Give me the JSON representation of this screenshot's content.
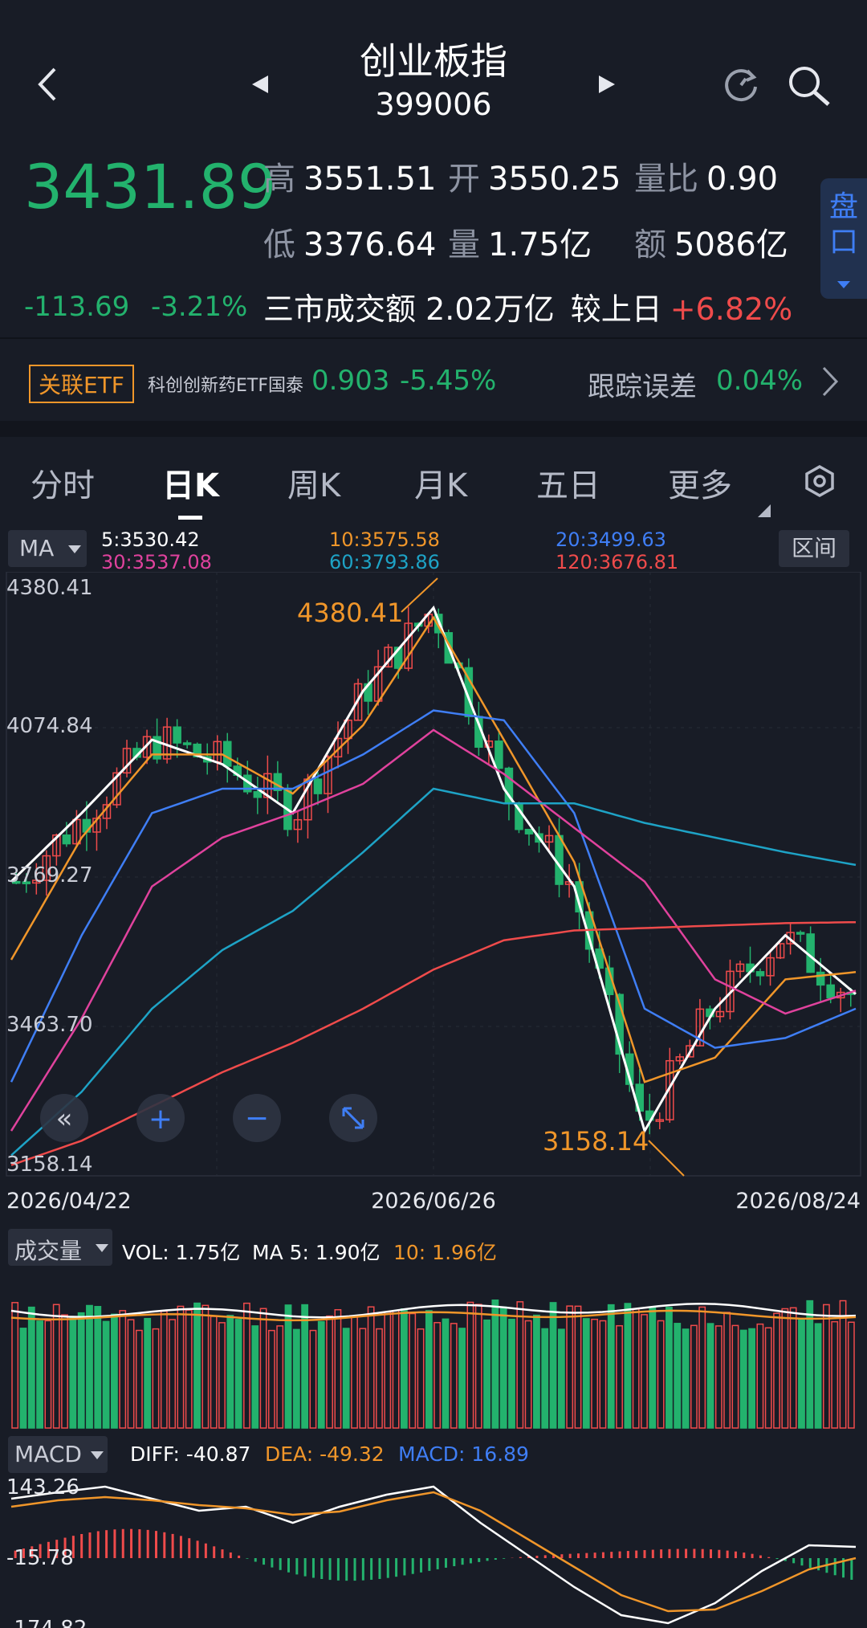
{
  "header": {
    "title": "创业板指",
    "code": "399006",
    "back_icon": "chevron-left-icon",
    "prev_icon": "triangle-left-icon",
    "next_icon": "triangle-right-icon",
    "refresh_icon": "refresh-icon",
    "search_icon": "search-icon"
  },
  "quote": {
    "price": "3431.89",
    "change": "-113.69",
    "change_pct": "-3.21%",
    "high_label": "高",
    "high": "3551.51",
    "open_label": "开",
    "open": "3550.25",
    "ratio_label": "量比",
    "ratio": "0.90",
    "low_label": "低",
    "low": "3376.64",
    "volume_label": "量",
    "volume": "1.75亿",
    "amount_label": "额",
    "amount": "5086亿",
    "market_text": "三市成交额 2.02万亿",
    "vs_label": "较上日",
    "vs_value": "+6.82%",
    "pankou_label": "盘口"
  },
  "etf": {
    "badge": "关联ETF",
    "name": "科创创新药ETF国泰",
    "price": "0.903",
    "pct": "-5.45%",
    "track_label": "跟踪误差",
    "track_value": "0.04%"
  },
  "tabs": [
    "分时",
    "日K",
    "周K",
    "月K",
    "五日",
    "更多"
  ],
  "active_tab": 1,
  "ma_bar": {
    "selector": "MA",
    "ma5": "5:3530.42",
    "ma10": "10:3575.58",
    "ma20": "20:3499.63",
    "ma30": "30:3537.08",
    "ma60": "60:3793.86",
    "ma120": "120:3676.81",
    "range_button": "区间"
  },
  "kchart": {
    "y_labels": [
      "4380.41",
      "4074.84",
      "3769.27",
      "3463.70",
      "3158.14"
    ],
    "high_marker": "4380.41",
    "low_marker": "3158.14",
    "dates": [
      "2026/04/22",
      "2026/06/26",
      "2026/08/24"
    ]
  },
  "volume_bar": {
    "selector": "成交量",
    "vol": "VOL: 1.75亿",
    "ma5": "MA 5: 1.90亿",
    "ma10": "10: 1.96亿"
  },
  "macd_bar": {
    "selector": "MACD",
    "diff": "DIFF: -40.87",
    "dea": "DEA: -49.32",
    "macd": "MACD: 16.89",
    "y_labels": [
      "143.26",
      "-15.78",
      "-174.82"
    ]
  },
  "colors": {
    "up": "#ef4b4b",
    "down": "#23b26d",
    "ma5": "#ffffff",
    "ma10": "#f0962a",
    "ma20": "#3f7ef5",
    "ma30": "#e0429d",
    "ma60": "#1ea3c6",
    "ma120": "#ef4b4b"
  },
  "chart_data": {
    "type": "line",
    "title": "",
    "x": [
      "2026/04/22",
      "2026/06/26",
      "2026/08/24"
    ],
    "ylim": [
      3158.14,
      4380.41
    ],
    "series": [
      {
        "name": "5",
        "values": [
          3760,
          3900,
          4050,
          4000,
          3900,
          4150,
          4320,
          3950,
          3750,
          3250,
          3500,
          3650,
          3530
        ]
      },
      {
        "name": "10",
        "values": [
          3600,
          3850,
          4020,
          4020,
          3940,
          4080,
          4300,
          4050,
          3800,
          3350,
          3400,
          3560,
          3575
        ]
      },
      {
        "name": "20",
        "values": [
          3350,
          3650,
          3900,
          3950,
          3950,
          4020,
          4110,
          4090,
          3900,
          3500,
          3420,
          3440,
          3500
        ]
      },
      {
        "name": "30",
        "values": [
          3250,
          3480,
          3750,
          3850,
          3900,
          3960,
          4070,
          3980,
          3870,
          3760,
          3560,
          3490,
          3537
        ]
      },
      {
        "name": "60",
        "values": [
          3200,
          3330,
          3500,
          3620,
          3700,
          3820,
          3950,
          3920,
          3920,
          3880,
          3850,
          3820,
          3794
        ]
      },
      {
        "name": "120",
        "values": [
          3180,
          3230,
          3300,
          3370,
          3430,
          3500,
          3580,
          3640,
          3660,
          3665,
          3670,
          3675,
          3677
        ]
      }
    ]
  }
}
